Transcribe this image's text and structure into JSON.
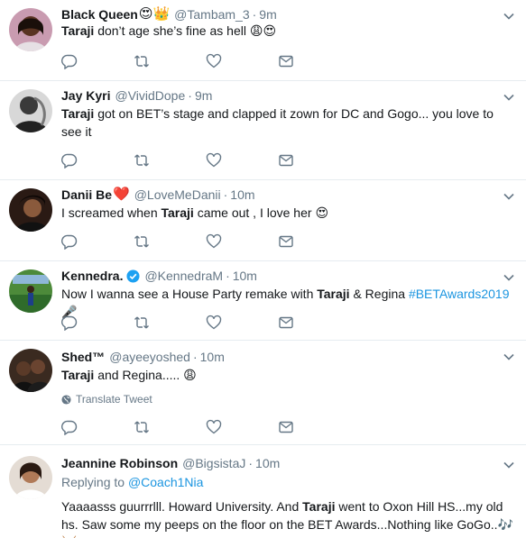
{
  "tweets": [
    {
      "fullname": "Black Queen",
      "name_emoji": "😍👑",
      "verified": false,
      "username": "@Tambam_3",
      "time": "9m",
      "text_parts": [
        {
          "t": "Taraji",
          "b": true
        },
        {
          "t": " don’t age she’s fine as hell ",
          "b": false
        },
        {
          "t": "😩😍",
          "b": false
        }
      ]
    },
    {
      "fullname": "Jay Kyri",
      "name_emoji": "",
      "verified": false,
      "username": "@VividDope",
      "time": "9m",
      "text_parts": [
        {
          "t": "Taraji",
          "b": true
        },
        {
          "t": " got on BET’s stage and clapped it zown for DC and Gogo... you love to see it",
          "b": false
        }
      ]
    },
    {
      "fullname": "Danii Be",
      "name_emoji": "❤️",
      "verified": false,
      "username": "@LoveMeDanii",
      "time": "10m",
      "text_parts": [
        {
          "t": "I screamed when ",
          "b": false
        },
        {
          "t": "Taraji",
          "b": true
        },
        {
          "t": " came out , I love her ",
          "b": false
        },
        {
          "t": "😍",
          "b": false
        }
      ]
    },
    {
      "fullname": "Kennedra.",
      "name_emoji": "",
      "verified": true,
      "username": "@KennedraM",
      "time": "10m",
      "text_parts": [
        {
          "t": "Now I wanna see a House Party remake with ",
          "b": false
        },
        {
          "t": "Taraji",
          "b": true
        },
        {
          "t": " & Regina ",
          "b": false
        },
        {
          "t": "#BETAwards2019",
          "b": false,
          "hashtag": true
        },
        {
          "t": " 🎤",
          "b": false
        }
      ]
    },
    {
      "fullname": "Shed™",
      "name_emoji": "",
      "verified": false,
      "username": "@ayeeyoshed",
      "time": "10m",
      "text_parts": [
        {
          "t": "Taraji",
          "b": true
        },
        {
          "t": " and Regina..... ",
          "b": false
        },
        {
          "t": "😩",
          "b": false
        }
      ],
      "translate": "Translate Tweet"
    },
    {
      "fullname": "Jeannine Robinson",
      "name_emoji": "",
      "verified": false,
      "username": "@BigsistaJ",
      "time": "10m",
      "reply_label": "Replying to",
      "reply_to": "@Coach1Nia",
      "text_parts": [
        {
          "t": "Yaaaasss guurrrlll.  Howard University. And ",
          "b": false
        },
        {
          "t": "Taraji",
          "b": true
        },
        {
          "t": " went to Oxon Hill HS...my old hs. Saw some my peeps on the floor on the BET Awards...Nothing like GoGo..",
          "b": false
        },
        {
          "t": "🎶🥁",
          "b": false
        }
      ]
    }
  ],
  "icons": [
    "reply-icon",
    "retweet-icon",
    "like-icon",
    "direct-message-icon",
    "caret-down-icon",
    "globe-icon",
    "verified-icon"
  ],
  "colors": {
    "secondary_text": "#657786",
    "link": "#1b95e0",
    "divider": "#e6ecf0",
    "verified": "#1da1f2"
  }
}
